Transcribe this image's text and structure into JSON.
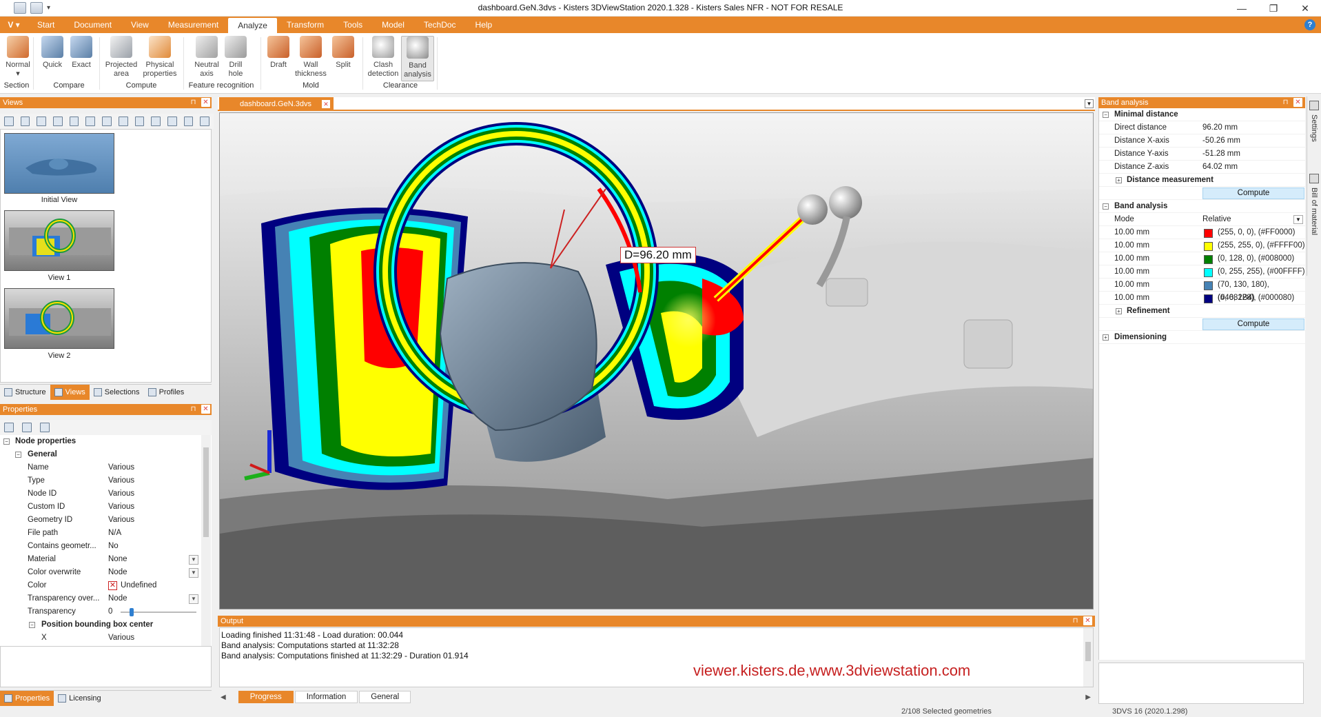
{
  "window": {
    "title": "dashboard.GeN.3dvs - Kisters 3DViewStation 2020.1.328 - Kisters Sales NFR - NOT FOR RESALE",
    "controls": [
      "—",
      "❐",
      "✕"
    ]
  },
  "menu": {
    "app_button": "V",
    "tabs": [
      "Start",
      "Document",
      "View",
      "Measurement",
      "Analyze",
      "Transform",
      "Tools",
      "Model",
      "TechDoc",
      "Help"
    ],
    "active_tab": "Analyze",
    "help": "?"
  },
  "ribbon": {
    "buttons": {
      "normal": "Normal",
      "quick": "Quick",
      "exact": "Exact",
      "projected_area_1": "Projected",
      "projected_area_2": "area",
      "physical_props_1": "Physical",
      "physical_props_2": "properties",
      "neutral_axis_1": "Neutral",
      "neutral_axis_2": "axis",
      "drill_hole_1": "Drill",
      "drill_hole_2": "hole",
      "draft": "Draft",
      "wall_thickness_1": "Wall",
      "wall_thickness_2": "thickness",
      "split": "Split",
      "clash_1": "Clash",
      "clash_2": "detection",
      "band_1": "Band",
      "band_2": "analysis"
    },
    "groups": {
      "section": "Section",
      "compare": "Compare",
      "compute": "Compute",
      "feature": "Feature recognition",
      "mold": "Mold",
      "clearance": "Clearance"
    }
  },
  "views_panel": {
    "title": "Views",
    "items": [
      "Initial View",
      "View 1",
      "View 2"
    ],
    "tabs": [
      "Structure",
      "Views",
      "Selections",
      "Profiles"
    ]
  },
  "properties_panel": {
    "title": "Properties",
    "root": "Node properties",
    "group": "General",
    "rows": [
      {
        "k": "Name",
        "v": "Various"
      },
      {
        "k": "Type",
        "v": "Various"
      },
      {
        "k": "Node ID",
        "v": "Various"
      },
      {
        "k": "Custom ID",
        "v": "Various"
      },
      {
        "k": "Geometry ID",
        "v": "Various"
      },
      {
        "k": "File path",
        "v": "N/A"
      },
      {
        "k": "Contains geometr...",
        "v": "No"
      },
      {
        "k": "Material",
        "v": "None"
      },
      {
        "k": "Color overwrite",
        "v": "Node"
      },
      {
        "k": "Color",
        "v": "Undefined"
      },
      {
        "k": "Transparency over...",
        "v": "Node"
      },
      {
        "k": "Transparency",
        "v": "0"
      }
    ],
    "subgroup": "Position bounding box center",
    "x_row": {
      "k": "X",
      "v": "Various"
    },
    "tabs": [
      "Properties",
      "Licensing"
    ]
  },
  "document": {
    "tab": "dashboard.GeN.3dvs",
    "measurement_label": "D=96.20 mm"
  },
  "output": {
    "title": "Output",
    "lines": [
      "Loading finished 11:31:48 - Load duration: 00.044",
      "Band analysis: Computations started at 11:32:28",
      "Band analysis: Computations finished at 11:32:29  - Duration 01.914"
    ],
    "tabs": [
      "Progress",
      "Information",
      "General"
    ],
    "watermark": "viewer.kisters.de,www.3dviewstation.com"
  },
  "band_panel": {
    "title": "Band analysis",
    "minimal_distance": "Minimal distance",
    "distances": [
      {
        "k": "Direct distance",
        "v": "96.20 mm"
      },
      {
        "k": "Distance X-axis",
        "v": "-50.26 mm"
      },
      {
        "k": "Distance Y-axis",
        "v": "-51.28 mm"
      },
      {
        "k": "Distance Z-axis",
        "v": "64.02 mm"
      }
    ],
    "distance_measurement": "Distance measurement",
    "compute": "Compute",
    "band_analysis": "Band analysis",
    "mode_label": "Mode",
    "mode_value": "Relative",
    "bands": [
      {
        "k": "10.00 mm",
        "color": "#FF0000",
        "v": "(255, 0, 0), (#FF0000)"
      },
      {
        "k": "10.00 mm",
        "color": "#FFFF00",
        "v": "(255, 255, 0), (#FFFF00)"
      },
      {
        "k": "10.00 mm",
        "color": "#008000",
        "v": "(0, 128, 0), (#008000)"
      },
      {
        "k": "10.00 mm",
        "color": "#00FFFF",
        "v": "(0, 255, 255), (#00FFFF)"
      },
      {
        "k": "10.00 mm",
        "color": "#4682B4",
        "v": "(70, 130, 180), (#4682B4)"
      },
      {
        "k": "10.00 mm",
        "color": "#000080",
        "v": "(0, 0, 128), (#000080)"
      }
    ],
    "refinement": "Refinement",
    "compute2": "Compute",
    "dimensioning": "Dimensioning",
    "side_tabs": [
      "Settings",
      "Bill of material"
    ]
  },
  "status": {
    "selection": "2/108 Selected geometries",
    "version": "3DVS 16 (2020.1.298)"
  },
  "colors": {
    "accent": "#e8872a",
    "compute_bg": "#d5ecfb"
  }
}
